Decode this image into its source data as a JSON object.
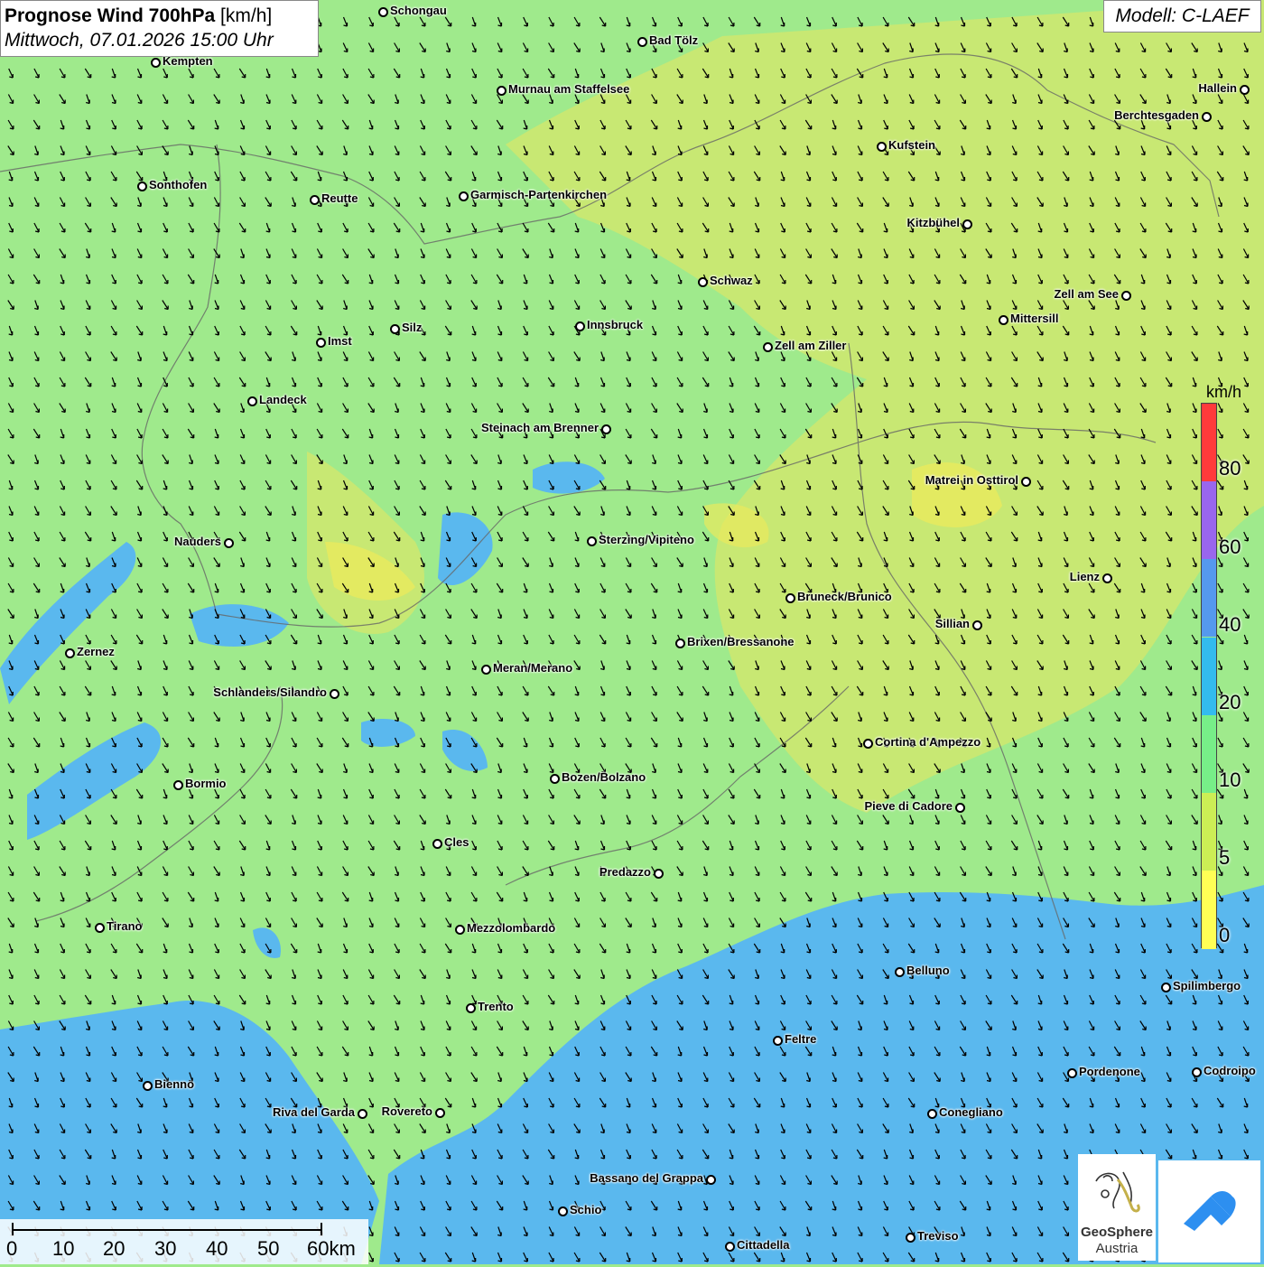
{
  "title": {
    "main_bold": "Prognose Wind 700hPa",
    "main_unit": "[km/h]",
    "subtitle": "Mittwoch, 07.01.2026 15:00 Uhr"
  },
  "model": "Modell: C-LAEF",
  "legend": {
    "unit": "km/h",
    "labels": [
      "80",
      "60",
      "40",
      "20",
      "10",
      "5",
      "0"
    ],
    "colors": [
      "#ff3b3b",
      "#9966ee",
      "#5599ee",
      "#33bbee",
      "#77ee88",
      "#ccee55",
      "#ffff55"
    ]
  },
  "scale": {
    "labels": [
      "0",
      "10",
      "20",
      "30",
      "40",
      "50",
      "60km"
    ]
  },
  "logo": {
    "name1": "GeoSphere",
    "name2": "Austria"
  },
  "colors": {
    "green": "#9fea8c",
    "yellow_green": "#cfe86e",
    "yellow": "#eaea5c",
    "blue": "#5ab8ee"
  },
  "cities": [
    {
      "name": "Schongau"
    },
    {
      "name": "Bad Tölz"
    },
    {
      "name": "Kempten"
    },
    {
      "name": "Murnau am Staffelsee"
    },
    {
      "name": "Hallein"
    },
    {
      "name": "Berchtesgaden"
    },
    {
      "name": "Kufstein"
    },
    {
      "name": "Sonthofen"
    },
    {
      "name": "Reutte"
    },
    {
      "name": "Garmisch-Partenkirchen"
    },
    {
      "name": "Kitzbühel"
    },
    {
      "name": "Schwaz"
    },
    {
      "name": "Zell am See"
    },
    {
      "name": "Mittersill"
    },
    {
      "name": "Innsbruck"
    },
    {
      "name": "Silz"
    },
    {
      "name": "Imst"
    },
    {
      "name": "Zell am Ziller"
    },
    {
      "name": "Landeck"
    },
    {
      "name": "Steinach am Brenner"
    },
    {
      "name": "Matrei in Osttirol"
    },
    {
      "name": "Nauders"
    },
    {
      "name": "Sterzing/Vipiteno"
    },
    {
      "name": "Lienz"
    },
    {
      "name": "Bruneck/Brunico"
    },
    {
      "name": "Sillian"
    },
    {
      "name": "Zernez"
    },
    {
      "name": "Brixen/Bressanone"
    },
    {
      "name": "Meran/Merano"
    },
    {
      "name": "Schlanders/Silandro"
    },
    {
      "name": "Cortina d'Ampezzo"
    },
    {
      "name": "Bozen/Bolzano"
    },
    {
      "name": "Bormio"
    },
    {
      "name": "Pieve di Cadore"
    },
    {
      "name": "Cles"
    },
    {
      "name": "Predazzo"
    },
    {
      "name": "Tirano"
    },
    {
      "name": "Mezzolombardo"
    },
    {
      "name": "Belluno"
    },
    {
      "name": "Spilimbergo"
    },
    {
      "name": "Trento"
    },
    {
      "name": "Feltre"
    },
    {
      "name": "Pordenone"
    },
    {
      "name": "Codroipo"
    },
    {
      "name": "Bienno"
    },
    {
      "name": "Riva del Garda"
    },
    {
      "name": "Rovereto"
    },
    {
      "name": "Conegliano"
    },
    {
      "name": "Bassano del Grappa"
    },
    {
      "name": "Schio"
    },
    {
      "name": "Treviso"
    },
    {
      "name": "Cittadella"
    }
  ]
}
